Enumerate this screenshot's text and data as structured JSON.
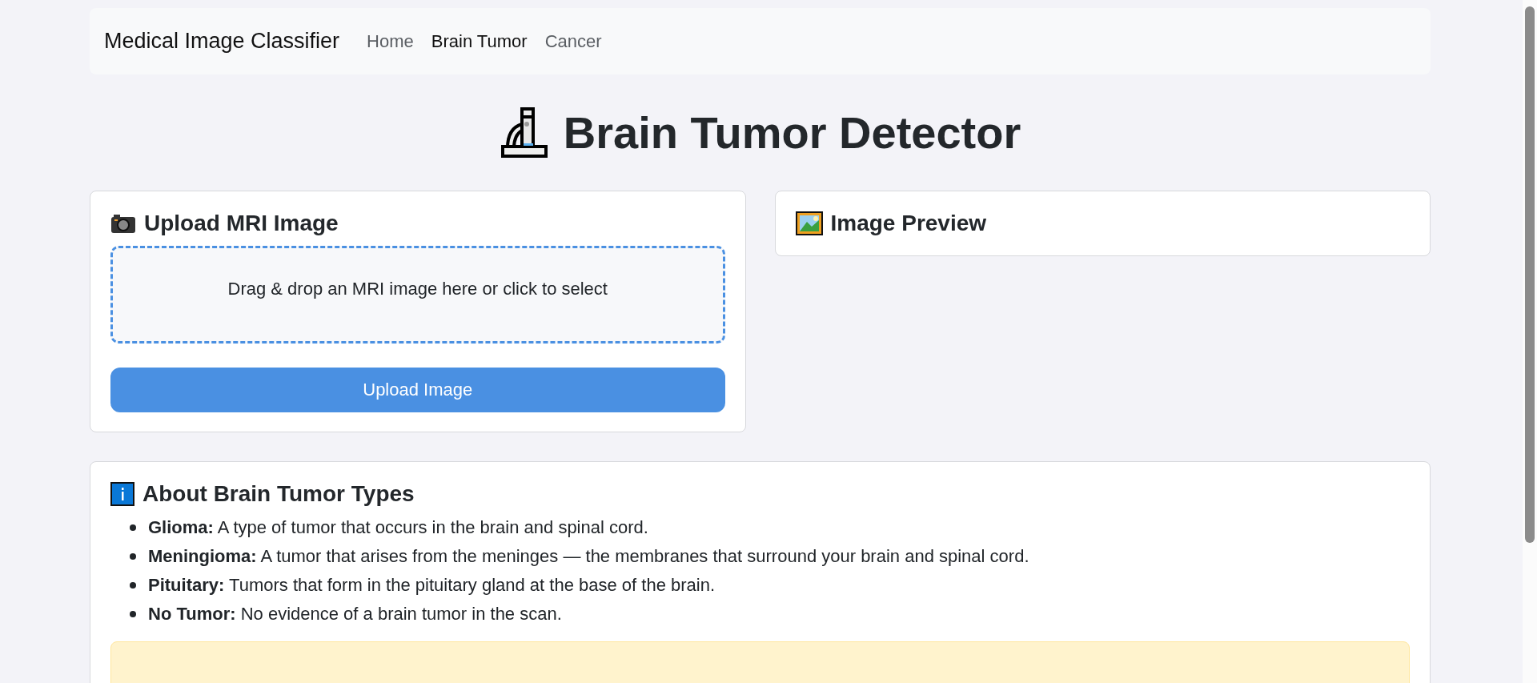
{
  "navbar": {
    "brand": "Medical Image Classifier",
    "links": [
      {
        "label": "Home",
        "selected": false
      },
      {
        "label": "Brain Tumor",
        "selected": true
      },
      {
        "label": "Cancer",
        "selected": false
      }
    ]
  },
  "title": "Brain Tumor Detector",
  "upload_card": {
    "title": "Upload MRI Image",
    "dropzone_text": "Drag & drop an MRI image here or click to select",
    "button": "Upload Image"
  },
  "preview_card": {
    "title": "Image Preview"
  },
  "about_card": {
    "title": "About Brain Tumor Types",
    "items": [
      "**Glioma:** A type of tumor that occurs in the brain and spinal cord.",
      "**Meningioma:** A tumor that arises from the meninges — the membranes that surround your brain and spinal cord.",
      "**Pituitary:** Tumors that form in the pituitary gland at the base of the brain.",
      "**No Tumor:** No evidence of a brain tumor in the scan."
    ],
    "alert": {
      "kind": "warning"
    }
  }
}
